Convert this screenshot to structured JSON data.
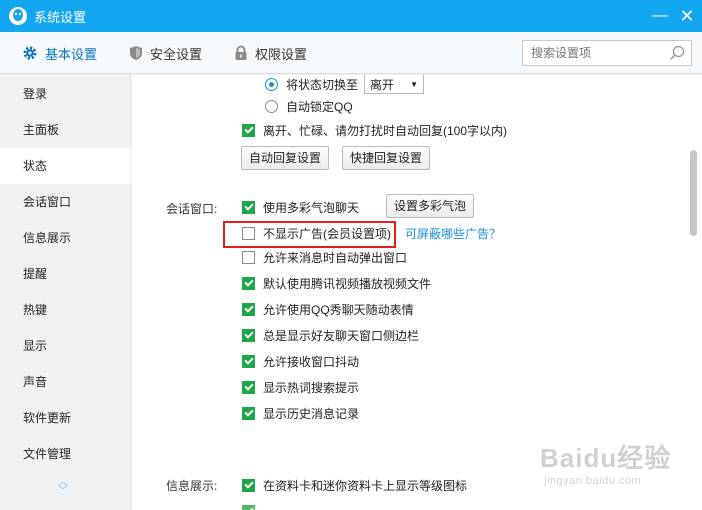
{
  "window": {
    "title": "系统设置"
  },
  "tabs": [
    {
      "label": "基本设置",
      "icon": "gear-icon"
    },
    {
      "label": "安全设置",
      "icon": "shield-icon"
    },
    {
      "label": "权限设置",
      "icon": "lock-icon"
    }
  ],
  "search": {
    "placeholder": "搜索设置项"
  },
  "sidebar": {
    "items": [
      "登录",
      "主面板",
      "状态",
      "会话窗口",
      "信息展示",
      "提醒",
      "热键",
      "显示",
      "声音",
      "软件更新",
      "文件管理"
    ],
    "active_index": 2
  },
  "status": {
    "switch_to_label": "将状态切换至",
    "switch_to_value": "离开",
    "auto_lock_label": "自动锁定QQ",
    "auto_reply_label": "离开、忙碌、请勿打扰时自动回复(100字以内)",
    "auto_reply_settings_btn": "自动回复设置",
    "quick_reply_settings_btn": "快捷回复设置"
  },
  "chat_window": {
    "section_label": "会话窗口:",
    "options": [
      {
        "label": "使用多彩气泡聊天",
        "checked": true
      },
      {
        "label": "不显示广告(会员设置项)",
        "checked": false
      },
      {
        "label": "允许来消息时自动弹出窗口",
        "checked": false
      },
      {
        "label": "默认使用腾讯视频播放视频文件",
        "checked": true
      },
      {
        "label": "允许使用QQ秀聊天随动表情",
        "checked": true
      },
      {
        "label": "总是显示好友聊天窗口侧边栏",
        "checked": true
      },
      {
        "label": "允许接收窗口抖动",
        "checked": true
      },
      {
        "label": "显示热词搜索提示",
        "checked": true
      },
      {
        "label": "显示历史消息记录",
        "checked": true
      }
    ],
    "bubble_settings_btn": "设置多彩气泡",
    "ads_link": "可屏蔽哪些广告？"
  },
  "info_display": {
    "section_label": "信息展示:",
    "options": [
      {
        "label": "在资料卡和迷你资料卡上显示等级图标",
        "checked": true
      }
    ]
  },
  "watermark": {
    "brand": "Baidu经验",
    "url": "jingyan.baidu.com"
  },
  "colors": {
    "titlebar": "#12a5f0",
    "accent": "#0b72c0",
    "check": "#1fa64b",
    "highlight": "#e02020"
  }
}
